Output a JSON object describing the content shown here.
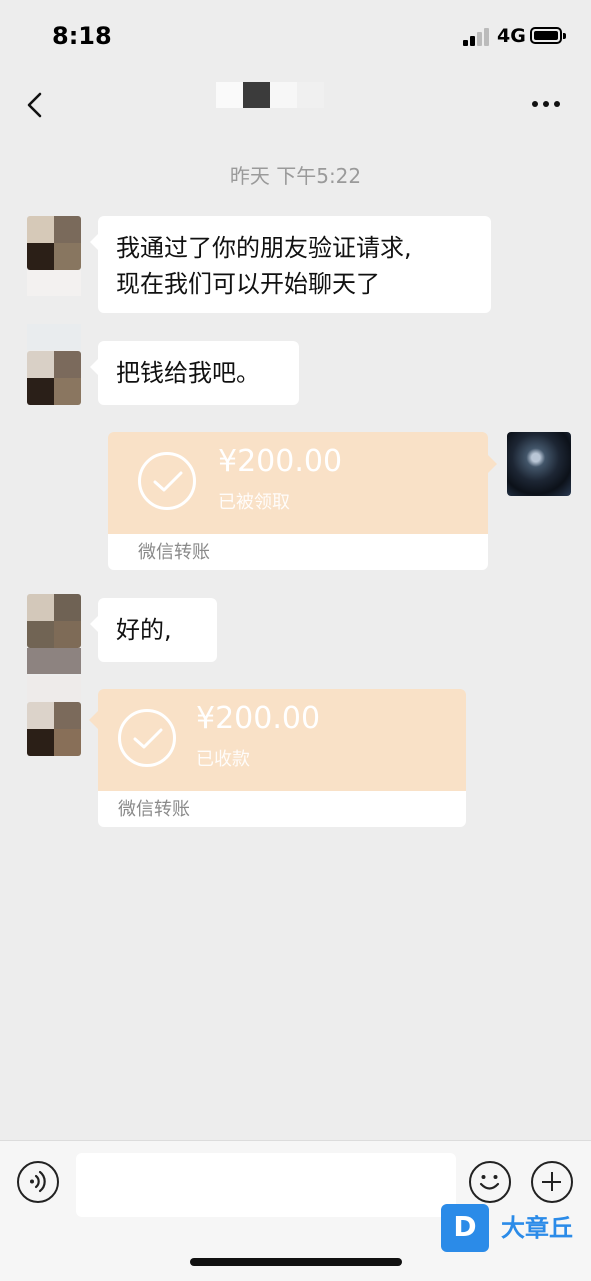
{
  "status_bar": {
    "time": "8:18",
    "network": "4G"
  },
  "nav": {
    "back_icon": "chevron-left-icon",
    "more_icon": "more-dots-icon"
  },
  "chat": {
    "timestamp": "昨天 下午5:22",
    "messages": [
      {
        "type": "text",
        "side": "left",
        "text_line1": "我通过了你的朋友验证请求,",
        "text_line2": "现在我们可以开始聊天了"
      },
      {
        "type": "text",
        "side": "left",
        "text": "把钱给我吧。"
      },
      {
        "type": "transfer",
        "side": "right",
        "amount": "¥200.00",
        "status": "已被领取",
        "footer": "微信转账"
      },
      {
        "type": "text",
        "side": "left",
        "text": "好的,"
      },
      {
        "type": "transfer",
        "side": "left",
        "amount": "¥200.00",
        "status": "已收款",
        "footer": "微信转账"
      }
    ]
  },
  "input_bar": {
    "voice_icon": "voice-icon",
    "emoji_icon": "emoji-icon",
    "plus_icon": "plus-icon",
    "placeholder": ""
  },
  "watermark": {
    "logo_letter": "D",
    "name": "大章丘"
  },
  "colors": {
    "background": "#ededed",
    "transfer": "#f9e1c7",
    "bubble": "#ffffff",
    "watermark": "#2b8be8"
  }
}
